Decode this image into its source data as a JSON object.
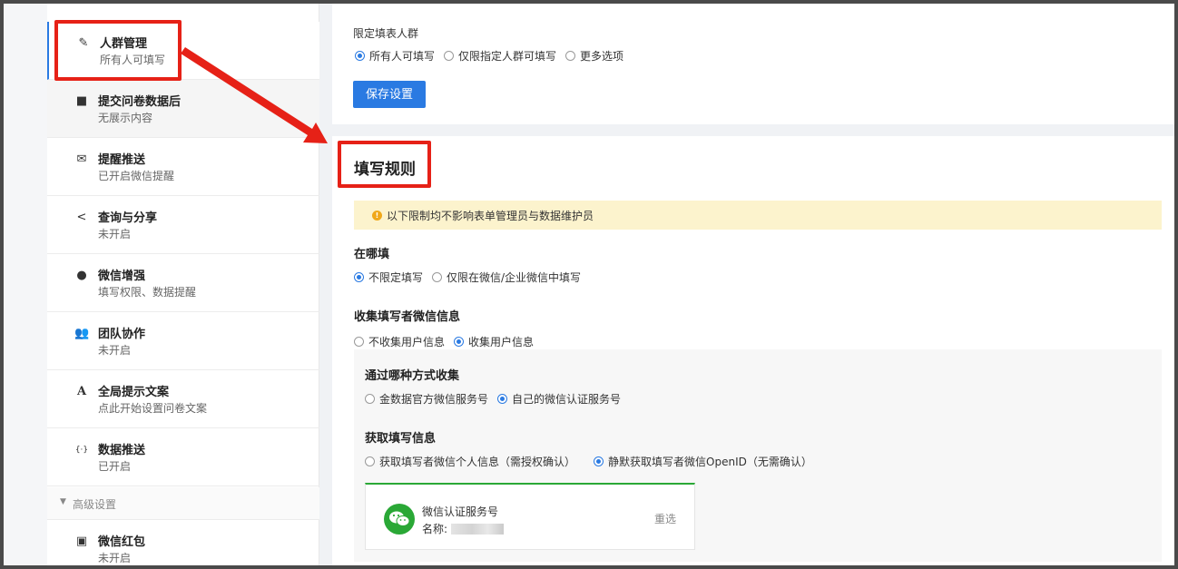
{
  "sidebar": {
    "items": [
      {
        "title": "人群管理",
        "sub": "所有人可填写",
        "icon": "pencil-icon",
        "glyph": "✎"
      },
      {
        "title": "提交问卷数据后",
        "sub": "无展示内容",
        "icon": "square-icon",
        "glyph": "■"
      },
      {
        "title": "提醒推送",
        "sub": "已开启微信提醒",
        "icon": "envelope-icon",
        "glyph": "✉"
      },
      {
        "title": "查询与分享",
        "sub": "未开启",
        "icon": "share-icon",
        "glyph": "<"
      },
      {
        "title": "微信增强",
        "sub": "填写权限、数据提醒",
        "icon": "wechat-icon",
        "glyph": "●"
      },
      {
        "title": "团队协作",
        "sub": "未开启",
        "icon": "team-icon",
        "glyph": "👥"
      },
      {
        "title": "全局提示文案",
        "sub": "点此开始设置问卷文案",
        "icon": "font-icon",
        "glyph": "A"
      },
      {
        "title": "数据推送",
        "sub": "已开启",
        "icon": "code-icon",
        "glyph": "{·}"
      }
    ],
    "section_label": "高级设置",
    "extra_item": {
      "title": "微信红包",
      "sub": "未开启",
      "icon": "gift-icon",
      "glyph": "▣"
    }
  },
  "restrict": {
    "label": "限定填表人群",
    "options": [
      "所有人可填写",
      "仅限指定人群可填写",
      "更多选项"
    ],
    "selected": 0,
    "save_label": "保存设置"
  },
  "rules": {
    "title": "填写规则",
    "notice": "以下限制均不影响表单管理员与数据维护员",
    "where": {
      "label": "在哪填",
      "options": [
        "不限定填写",
        "仅限在微信/企业微信中填写"
      ],
      "selected": 0
    },
    "collect": {
      "label": "收集填写者微信信息",
      "options": [
        "不收集用户信息",
        "收集用户信息"
      ],
      "selected": 1
    },
    "method": {
      "label": "通过哪种方式收集",
      "options": [
        "金数据官方微信服务号",
        "自己的微信认证服务号"
      ],
      "selected": 1
    },
    "fetch": {
      "label": "获取填写信息",
      "options": [
        "获取填写者微信个人信息（需授权确认）",
        "静默获取填写者微信OpenID（无需确认）"
      ],
      "selected": 1
    },
    "wx_card": {
      "name": "微信认证服务号",
      "sub_label": "名称:",
      "reselect": "重选"
    }
  },
  "colors": {
    "accent": "#2a7ae2",
    "highlight": "#e62117",
    "notice_bg": "#fcf3cd",
    "wechat": "#2aa836"
  }
}
